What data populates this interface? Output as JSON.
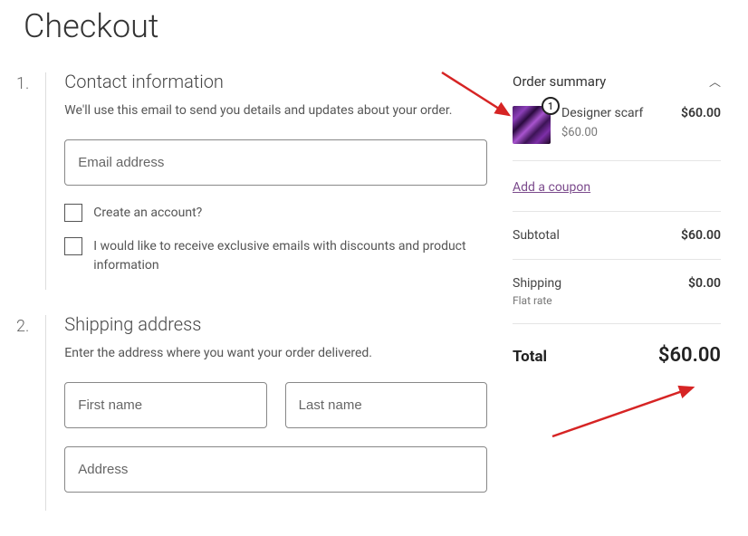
{
  "page_title": "Checkout",
  "steps": {
    "contact": {
      "number": "1.",
      "heading": "Contact information",
      "description": "We'll use this email to send you details and updates about your order.",
      "email_placeholder": "Email address",
      "create_account_label": "Create an account?",
      "subscribe_label": "I would like to receive exclusive emails with discounts and product information"
    },
    "shipping": {
      "number": "2.",
      "heading": "Shipping address",
      "description": "Enter the address where you want your order delivered.",
      "first_name_placeholder": "First name",
      "last_name_placeholder": "Last name",
      "address_placeholder": "Address"
    }
  },
  "summary": {
    "title": "Order summary",
    "item": {
      "qty": "1",
      "name": "Designer scarf",
      "unit_price": "$60.00",
      "line_total": "$60.00"
    },
    "coupon_label": "Add a coupon",
    "subtotal_label": "Subtotal",
    "subtotal_value": "$60.00",
    "shipping_label": "Shipping",
    "shipping_method": "Flat rate",
    "shipping_value": "$0.00",
    "total_label": "Total",
    "total_value": "$60.00"
  }
}
